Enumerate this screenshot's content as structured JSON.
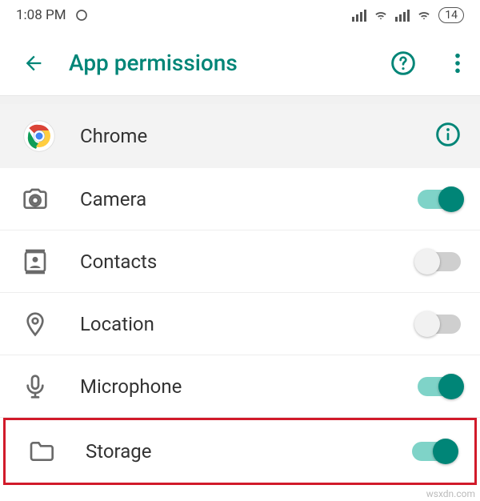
{
  "statusbar": {
    "time": "1:08 PM",
    "battery": "14"
  },
  "appbar": {
    "title": "App permissions"
  },
  "app": {
    "name": "Chrome"
  },
  "permissions": [
    {
      "id": "camera",
      "label": "Camera",
      "enabled": true,
      "icon": "camera-icon"
    },
    {
      "id": "contacts",
      "label": "Contacts",
      "enabled": false,
      "icon": "contacts-icon"
    },
    {
      "id": "location",
      "label": "Location",
      "enabled": false,
      "icon": "location-icon"
    },
    {
      "id": "microphone",
      "label": "Microphone",
      "enabled": true,
      "icon": "microphone-icon"
    },
    {
      "id": "storage",
      "label": "Storage",
      "enabled": true,
      "icon": "storage-icon",
      "highlighted": true
    }
  ],
  "colors": {
    "accent": "#008577",
    "highlight": "#d11a2a"
  },
  "watermark": "wsxdn.com"
}
